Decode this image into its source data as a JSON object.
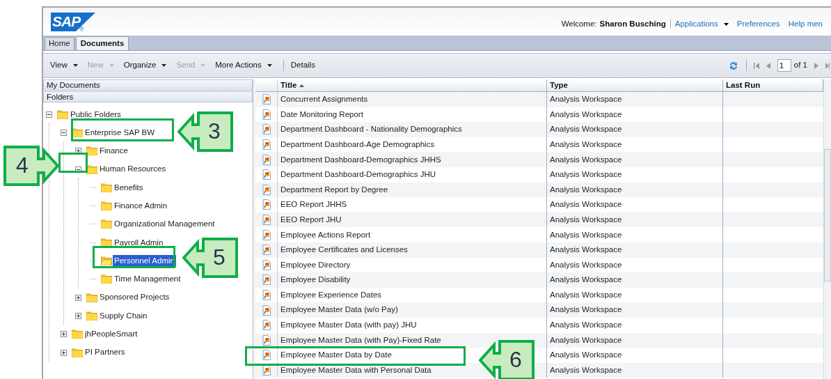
{
  "header": {
    "logo": "SAP",
    "logo_mark": "®",
    "welcome_label": "Welcome:",
    "user": "Sharon Busching",
    "links": [
      {
        "label": "Applications",
        "dropdown": true
      },
      {
        "label": "Preferences",
        "dropdown": false
      },
      {
        "label": "Help men",
        "dropdown": false
      }
    ]
  },
  "tabs": [
    {
      "label": "Home",
      "selected": false
    },
    {
      "label": "Documents",
      "selected": true
    }
  ],
  "toolbar": [
    {
      "label": "View",
      "dropdown": true,
      "disabled": false
    },
    {
      "label": "New",
      "dropdown": true,
      "disabled": true
    },
    {
      "label": "Organize",
      "dropdown": true,
      "disabled": false
    },
    {
      "label": "Send",
      "dropdown": true,
      "disabled": true
    },
    {
      "label": "More Actions",
      "dropdown": true,
      "disabled": false
    },
    {
      "label": "Details",
      "dropdown": false,
      "disabled": false
    }
  ],
  "pager": {
    "page": "1",
    "of": "of 1"
  },
  "sidebar": {
    "sections": [
      "My Documents",
      "Folders"
    ],
    "tree": [
      {
        "label": "Public Folders",
        "expanded": true,
        "selected": false,
        "children": [
          {
            "label": "Enterprise SAP BW",
            "expanded": true,
            "selected": false,
            "children": [
              {
                "label": "Finance",
                "expanded": false,
                "selected": false
              },
              {
                "label": "Human Resources",
                "expanded": true,
                "selected": false,
                "children": [
                  {
                    "label": "Benefits",
                    "selected": false
                  },
                  {
                    "label": "Finance Admin",
                    "selected": false
                  },
                  {
                    "label": "Organizational Management",
                    "selected": false
                  },
                  {
                    "label": "Payroll Admin",
                    "selected": false
                  },
                  {
                    "label": "Personnel Admin",
                    "selected": true
                  },
                  {
                    "label": "Time Management",
                    "selected": false
                  }
                ]
              },
              {
                "label": "Sponsored Projects",
                "expanded": false,
                "selected": false
              },
              {
                "label": "Supply Chain",
                "expanded": false,
                "selected": false
              }
            ]
          },
          {
            "label": "jhPeopleSmart",
            "expanded": false,
            "selected": false
          },
          {
            "label": "PI Partners",
            "expanded": false,
            "selected": false
          }
        ]
      }
    ]
  },
  "table": {
    "columns": [
      {
        "label": "Title",
        "sorted": true
      },
      {
        "label": "Type",
        "sorted": false
      },
      {
        "label": "Last Run",
        "sorted": false
      }
    ],
    "rows": [
      {
        "title": "Concurrent Assignments",
        "type": "Analysis Workspace"
      },
      {
        "title": "Date Monitoring Report",
        "type": "Analysis Workspace"
      },
      {
        "title": "Department Dashboard - Nationality Demographics",
        "type": "Analysis Workspace"
      },
      {
        "title": "Department Dashboard-Age Demographics",
        "type": "Analysis Workspace"
      },
      {
        "title": "Department Dashboard-Demographics JHHS",
        "type": "Analysis Workspace"
      },
      {
        "title": "Department Dashboard-Demographics JHU",
        "type": "Analysis Workspace"
      },
      {
        "title": "Department Report by Degree",
        "type": "Analysis Workspace"
      },
      {
        "title": "EEO Report JHHS",
        "type": "Analysis Workspace"
      },
      {
        "title": "EEO Report JHU",
        "type": "Analysis Workspace"
      },
      {
        "title": "Employee Actions Report",
        "type": "Analysis Workspace"
      },
      {
        "title": "Employee Certificates and Licenses",
        "type": "Analysis Workspace"
      },
      {
        "title": "Employee Directory",
        "type": "Analysis Workspace"
      },
      {
        "title": "Employee Disability",
        "type": "Analysis Workspace"
      },
      {
        "title": "Employee Experience Dates",
        "type": "Analysis Workspace"
      },
      {
        "title": "Employee Master Data (w/o Pay)",
        "type": "Analysis Workspace"
      },
      {
        "title": "Employee Master Data (with pay) JHU",
        "type": "Analysis Workspace"
      },
      {
        "title": "Employee Master Data (with Pay)-Fixed Rate",
        "type": "Analysis Workspace"
      },
      {
        "title": "Employee Master Data by Date",
        "type": "Analysis Workspace"
      },
      {
        "title": "Employee Master Data with Personal Data",
        "type": "Analysis Workspace"
      }
    ]
  },
  "annotations": [
    {
      "label": "3",
      "kind": "left"
    },
    {
      "label": "4",
      "kind": "right"
    },
    {
      "label": "5",
      "kind": "left"
    },
    {
      "label": "6",
      "kind": "left"
    }
  ]
}
